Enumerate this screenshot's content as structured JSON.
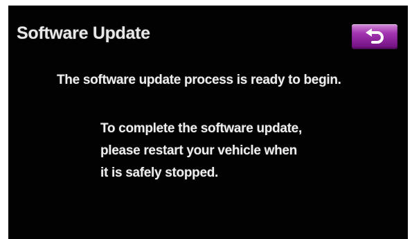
{
  "screen": {
    "title": "Software Update",
    "back_button_icon": "back-arrow-icon",
    "accent_color": "#a436b3",
    "messages": {
      "ready": "The software update process is ready to begin.",
      "instructions": [
        "To complete the software update,",
        "please restart your vehicle when",
        "it is safely stopped."
      ]
    }
  }
}
